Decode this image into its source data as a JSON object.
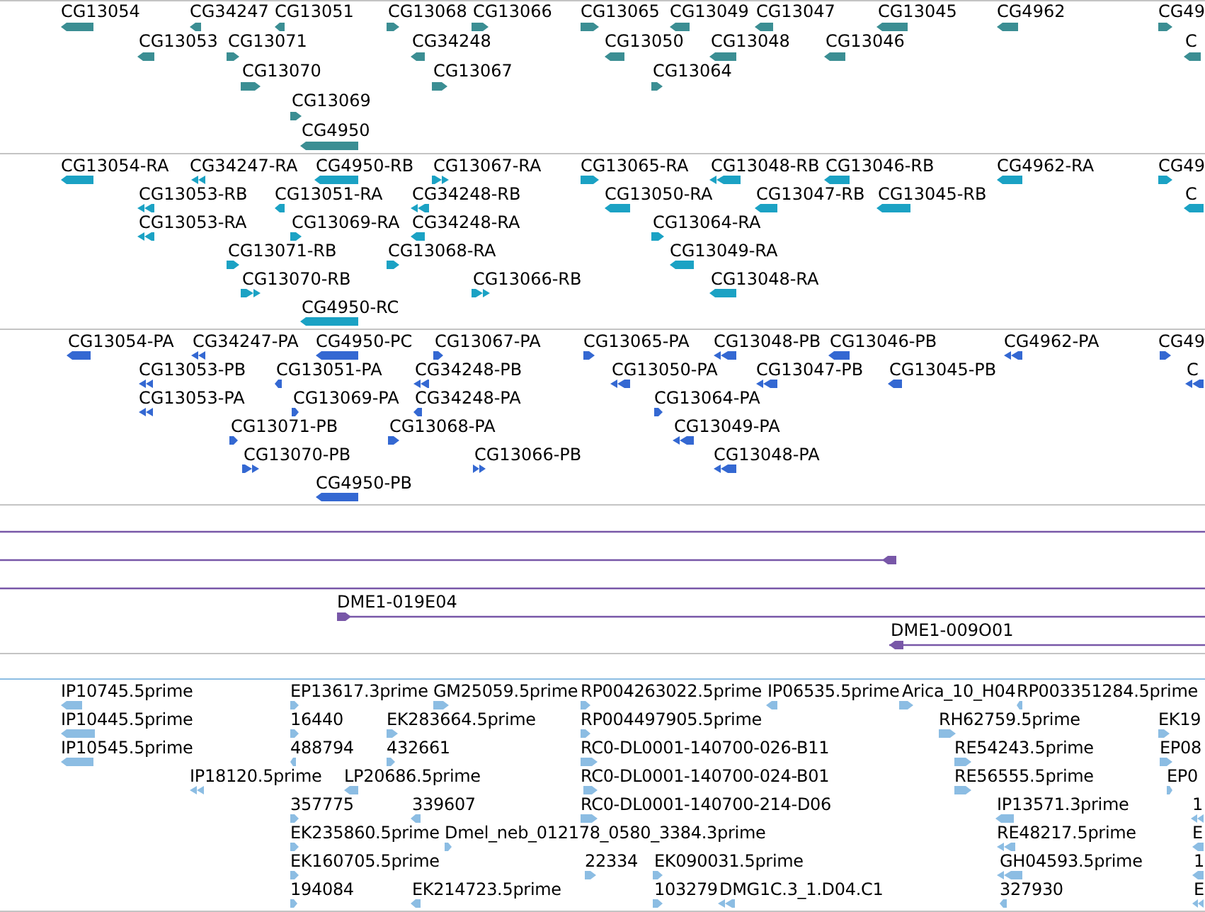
{
  "tracks": [
    {
      "kind": "gene",
      "features": [
        {
          "label": "CG13054",
          "reverse": true
        },
        {
          "label": "CG34247",
          "reverse": true
        },
        {
          "label": "CG13051",
          "reverse": true
        },
        {
          "label": "CG13068",
          "reverse": false
        },
        {
          "label": "CG13066",
          "reverse": false
        },
        {
          "label": "CG13065",
          "reverse": false
        },
        {
          "label": "CG13049",
          "reverse": true
        },
        {
          "label": "CG13047",
          "reverse": true
        },
        {
          "label": "CG13045",
          "reverse": true
        },
        {
          "label": "CG4962",
          "reverse": true
        },
        {
          "label": "CG49",
          "reverse": false
        },
        {
          "label": "CG13053",
          "reverse": true
        },
        {
          "label": "CG13071",
          "reverse": false
        },
        {
          "label": "CG34248",
          "reverse": true
        },
        {
          "label": "CG13050",
          "reverse": true
        },
        {
          "label": "CG13048",
          "reverse": true
        },
        {
          "label": "CG13046",
          "reverse": true
        },
        {
          "label": "C",
          "reverse": true
        },
        {
          "label": "CG13070",
          "reverse": false
        },
        {
          "label": "CG13067",
          "reverse": false
        },
        {
          "label": "CG13064",
          "reverse": false
        },
        {
          "label": "CG13069",
          "reverse": false
        },
        {
          "label": "CG4950",
          "reverse": true
        }
      ]
    },
    {
      "kind": "transcript",
      "features": [
        {
          "label": "CG13054-RA",
          "reverse": true
        },
        {
          "label": "CG34247-RA",
          "reverse": true
        },
        {
          "label": "CG4950-RB",
          "reverse": true
        },
        {
          "label": "CG13067-RA",
          "reverse": false
        },
        {
          "label": "CG13065-RA",
          "reverse": false
        },
        {
          "label": "CG13048-RB",
          "reverse": true
        },
        {
          "label": "CG13046-RB",
          "reverse": true
        },
        {
          "label": "CG4962-RA",
          "reverse": true
        },
        {
          "label": "CG49",
          "reverse": false
        },
        {
          "label": "CG13053-RB",
          "reverse": true
        },
        {
          "label": "CG13051-RA",
          "reverse": true
        },
        {
          "label": "CG34248-RB",
          "reverse": true
        },
        {
          "label": "CG13050-RA",
          "reverse": true
        },
        {
          "label": "CG13047-RB",
          "reverse": true
        },
        {
          "label": "CG13045-RB",
          "reverse": true
        },
        {
          "label": "C",
          "reverse": true
        },
        {
          "label": "CG13053-RA",
          "reverse": true
        },
        {
          "label": "CG13069-RA",
          "reverse": false
        },
        {
          "label": "CG34248-RA",
          "reverse": true
        },
        {
          "label": "CG13064-RA",
          "reverse": false
        },
        {
          "label": "CG13071-RB",
          "reverse": false
        },
        {
          "label": "CG13068-RA",
          "reverse": false
        },
        {
          "label": "CG13049-RA",
          "reverse": true
        },
        {
          "label": "CG13070-RB",
          "reverse": false
        },
        {
          "label": "CG13066-RB",
          "reverse": false
        },
        {
          "label": "CG13048-RA",
          "reverse": true
        },
        {
          "label": "CG4950-RC",
          "reverse": true
        }
      ]
    },
    {
      "kind": "protein",
      "features": [
        {
          "label": "CG13054-PA",
          "reverse": true
        },
        {
          "label": "CG34247-PA",
          "reverse": true
        },
        {
          "label": "CG4950-PC",
          "reverse": true
        },
        {
          "label": "CG13067-PA",
          "reverse": false
        },
        {
          "label": "CG13065-PA",
          "reverse": false
        },
        {
          "label": "CG13048-PB",
          "reverse": true
        },
        {
          "label": "CG13046-PB",
          "reverse": true
        },
        {
          "label": "CG4962-PA",
          "reverse": true
        },
        {
          "label": "CG49",
          "reverse": false
        },
        {
          "label": "CG13053-PB",
          "reverse": true
        },
        {
          "label": "CG13051-PA",
          "reverse": true
        },
        {
          "label": "CG34248-PB",
          "reverse": true
        },
        {
          "label": "CG13050-PA",
          "reverse": true
        },
        {
          "label": "CG13047-PB",
          "reverse": true
        },
        {
          "label": "CG13045-PB",
          "reverse": true
        },
        {
          "label": "C",
          "reverse": true
        },
        {
          "label": "CG13053-PA",
          "reverse": true
        },
        {
          "label": "CG13069-PA",
          "reverse": false
        },
        {
          "label": "CG34248-PA",
          "reverse": true
        },
        {
          "label": "CG13064-PA",
          "reverse": false
        },
        {
          "label": "CG13071-PB",
          "reverse": false
        },
        {
          "label": "CG13068-PA",
          "reverse": false
        },
        {
          "label": "CG13049-PA",
          "reverse": true
        },
        {
          "label": "CG13070-PB",
          "reverse": false
        },
        {
          "label": "CG13066-PB",
          "reverse": false
        },
        {
          "label": "CG13048-PA",
          "reverse": true
        },
        {
          "label": "CG4950-PB",
          "reverse": true
        }
      ]
    },
    {
      "kind": "clone",
      "features": [
        {
          "clipped": true
        },
        {
          "clipped": false,
          "reverse": true
        },
        {
          "clipped": true
        },
        {
          "label": "DME1-019E04",
          "clipped": false,
          "reverse": false
        },
        {
          "label": "DME1-009O01",
          "clipped": false,
          "reverse": true
        }
      ]
    },
    {
      "kind": "est",
      "features": [
        {
          "label": "IP10745.5prime",
          "reverse": true
        },
        {
          "label": "EP13617.3prime",
          "reverse": false
        },
        {
          "label": "GM25059.5prime",
          "reverse": false
        },
        {
          "label": "RP004263022.5prime",
          "reverse": false
        },
        {
          "label": "IP06535.5prime",
          "reverse": true
        },
        {
          "label": "Arica_10_H04",
          "reverse": false
        },
        {
          "label": "RP003351284.5prime",
          "reverse": true
        },
        {
          "label": "IP10445.5prime",
          "reverse": true
        },
        {
          "label": "16440",
          "reverse": false
        },
        {
          "label": "EK283664.5prime",
          "reverse": false
        },
        {
          "label": "RP004497905.5prime",
          "reverse": false
        },
        {
          "label": "RH62759.5prime",
          "reverse": false
        },
        {
          "label": "EK19",
          "reverse": false
        },
        {
          "label": "IP10545.5prime",
          "reverse": true
        },
        {
          "label": "488794",
          "reverse": true
        },
        {
          "label": "432661",
          "reverse": false
        },
        {
          "label": "RC0-DL0001-140700-026-B11",
          "reverse": false
        },
        {
          "label": "RE54243.5prime",
          "reverse": false
        },
        {
          "label": "EP08",
          "reverse": false
        },
        {
          "label": "IP18120.5prime",
          "reverse": true
        },
        {
          "label": "LP20686.5prime",
          "reverse": true
        },
        {
          "label": "RC0-DL0001-140700-024-B01",
          "reverse": false
        },
        {
          "label": "RE56555.5prime",
          "reverse": false
        },
        {
          "label": "EP0",
          "reverse": false
        },
        {
          "label": "357775",
          "reverse": false
        },
        {
          "label": "339607",
          "reverse": true
        },
        {
          "label": "RC0-DL0001-140700-214-D06",
          "reverse": false
        },
        {
          "label": "IP13571.3prime",
          "reverse": true
        },
        {
          "label": "1",
          "reverse": true
        },
        {
          "label": "EK235860.5prime",
          "reverse": false
        },
        {
          "label": "Dmel_neb_012178_0580_3384.3prime",
          "reverse": false
        },
        {
          "label": "RE48217.5prime",
          "reverse": true
        },
        {
          "label": "E",
          "reverse": true
        },
        {
          "label": "EK160705.5prime",
          "reverse": false
        },
        {
          "label": "22334",
          "reverse": false
        },
        {
          "label": "EK090031.5prime",
          "reverse": false
        },
        {
          "label": "GH04593.5prime",
          "reverse": true
        },
        {
          "label": "1",
          "reverse": true
        },
        {
          "label": "194084",
          "reverse": false
        },
        {
          "label": "EK214723.5prime",
          "reverse": true
        },
        {
          "label": "103279",
          "reverse": false
        },
        {
          "label": "DMG1C.3_1.D04.C1",
          "reverse": true
        },
        {
          "label": "327930",
          "reverse": true
        },
        {
          "label": "E",
          "reverse": true
        }
      ]
    }
  ]
}
